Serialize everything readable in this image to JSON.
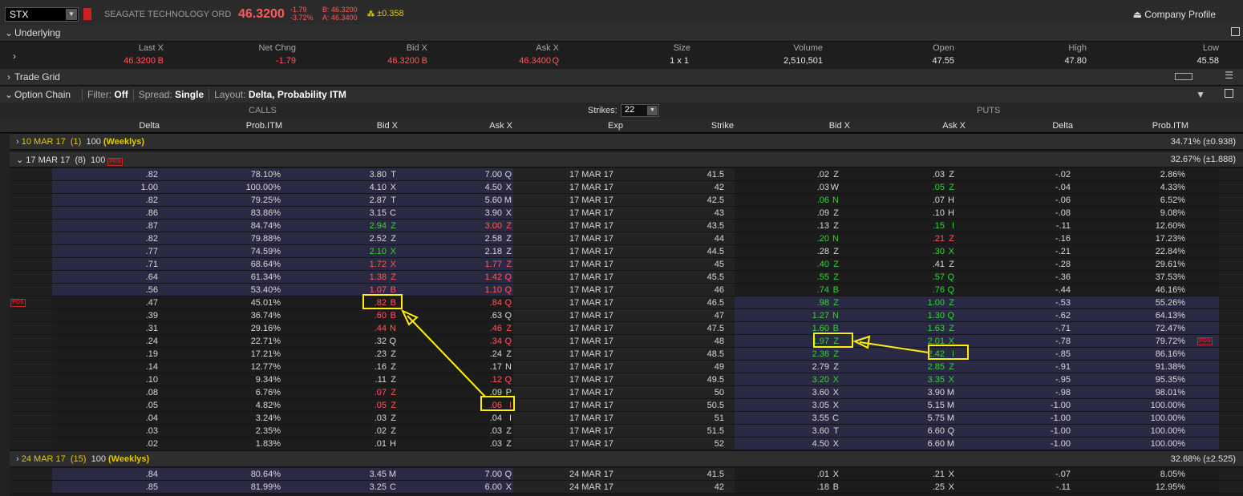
{
  "header": {
    "symbol": "STX",
    "company": "SEAGATE TECHNOLOGY ORD",
    "last": "46.3200",
    "chg1": "-1.79",
    "chg2": "-3.72%",
    "bid": "B: 46.3200",
    "ask": "A: 46.3400",
    "mm": "±0.358",
    "company_profile": "Company Profile"
  },
  "underlying": {
    "title": "Underlying",
    "headers": [
      "Last X",
      "Net Chng",
      "Bid X",
      "Ask X",
      "Size",
      "Volume",
      "Open",
      "High",
      "Low"
    ],
    "last": "46.3200",
    "last_x": "B",
    "net": "-1.79",
    "bid": "46.3200",
    "bid_x": "B",
    "ask": "46.3400",
    "ask_x": "Q",
    "size": "1 x 1",
    "volume": "2,510,501",
    "open": "47.55",
    "high": "47.80",
    "low": "45.58"
  },
  "trade_grid": {
    "title": "Trade Grid"
  },
  "option_chain": {
    "title": "Option Chain",
    "filter_label": "Filter:",
    "filter": "Off",
    "spread_label": "Spread:",
    "spread": "Single",
    "layout_label": "Layout:",
    "layout": "Delta, Probability ITM",
    "calls": "CALLS",
    "puts": "PUTS",
    "strikes_label": "Strikes:",
    "strikes": "22",
    "columns": {
      "delta": "Delta",
      "prob": "Prob.ITM",
      "bid": "Bid X",
      "ask": "Ask X",
      "exp": "Exp",
      "strike": "Strike"
    }
  },
  "groups": [
    {
      "label": "10 MAR 17",
      "count": "(1)",
      "mult": "100",
      "tag": "(Weeklys)",
      "right": "34.71% (±0.938)"
    },
    {
      "label": "17 MAR 17",
      "count": "(8)",
      "mult": "100",
      "tag": "",
      "right": "32.67% (±1.888)"
    },
    {
      "label": "24 MAR 17",
      "count": "(15)",
      "mult": "100",
      "tag": "(Weeklys)",
      "right": "32.68% (±2.525)"
    }
  ],
  "pos_label": "POS",
  "rows": [
    {
      "cd": ".82",
      "cp": "78.10%",
      "cb": "3.80",
      "cbx": "T",
      "ca": "7.00",
      "cax": "Q",
      "exp": "17 MAR 17",
      "k": "41.5",
      "pb": ".02",
      "pbx": "Z",
      "pa": ".03",
      "pax": "Z",
      "pd": "-.02",
      "pp": "2.86%"
    },
    {
      "cd": "1.00",
      "cp": "100.00%",
      "cb": "4.10",
      "cbx": "X",
      "ca": "4.50",
      "cax": "X",
      "exp": "17 MAR 17",
      "k": "42",
      "pb": ".03",
      "pbx": "W",
      "pa": ".05",
      "pax": "Z",
      "pd": "-.04",
      "pp": "4.33%"
    },
    {
      "cd": ".82",
      "cp": "79.25%",
      "cb": "2.87",
      "cbx": "T",
      "ca": "5.60",
      "cax": "M",
      "exp": "17 MAR 17",
      "k": "42.5",
      "pb": ".06",
      "pbx": "N",
      "pa": ".07",
      "pax": "H",
      "pd": "-.06",
      "pp": "6.52%"
    },
    {
      "cd": ".86",
      "cp": "83.86%",
      "cb": "3.15",
      "cbx": "C",
      "ca": "3.90",
      "cax": "X",
      "exp": "17 MAR 17",
      "k": "43",
      "pb": ".09",
      "pbx": "Z",
      "pa": ".10",
      "pax": "H",
      "pd": "-.08",
      "pp": "9.08%"
    },
    {
      "cd": ".87",
      "cp": "84.74%",
      "cb": "2.94",
      "cbx": "Z",
      "ca": "3.00",
      "cax": "Z",
      "exp": "17 MAR 17",
      "k": "43.5",
      "pb": ".13",
      "pbx": "Z",
      "pa": ".15",
      "pax": "I",
      "pd": "-.11",
      "pp": "12.60%"
    },
    {
      "cd": ".82",
      "cp": "79.88%",
      "cb": "2.52",
      "cbx": "Z",
      "ca": "2.58",
      "cax": "Z",
      "exp": "17 MAR 17",
      "k": "44",
      "pb": ".20",
      "pbx": "N",
      "pa": ".21",
      "pax": "Z",
      "pd": "-.16",
      "pp": "17.23%"
    },
    {
      "cd": ".77",
      "cp": "74.59%",
      "cb": "2.10",
      "cbx": "X",
      "ca": "2.18",
      "cax": "Z",
      "exp": "17 MAR 17",
      "k": "44.5",
      "pb": ".28",
      "pbx": "Z",
      "pa": ".30",
      "pax": "X",
      "pd": "-.21",
      "pp": "22.84%"
    },
    {
      "cd": ".71",
      "cp": "68.64%",
      "cb": "1.72",
      "cbx": "X",
      "ca": "1.77",
      "cax": "Z",
      "exp": "17 MAR 17",
      "k": "45",
      "pb": ".40",
      "pbx": "Z",
      "pa": ".41",
      "pax": "Z",
      "pd": "-.28",
      "pp": "29.61%"
    },
    {
      "cd": ".64",
      "cp": "61.34%",
      "cb": "1.38",
      "cbx": "Z",
      "ca": "1.42",
      "cax": "Q",
      "exp": "17 MAR 17",
      "k": "45.5",
      "pb": ".55",
      "pbx": "Z",
      "pa": ".57",
      "pax": "Q",
      "pd": "-.36",
      "pp": "37.53%"
    },
    {
      "cd": ".56",
      "cp": "53.40%",
      "cb": "1.07",
      "cbx": "B",
      "ca": "1.10",
      "cax": "Q",
      "exp": "17 MAR 17",
      "k": "46",
      "pb": ".74",
      "pbx": "B",
      "pa": ".76",
      "pax": "Q",
      "pd": "-.44",
      "pp": "46.16%"
    },
    {
      "cd": ".47",
      "cp": "45.01%",
      "cb": ".82",
      "cbx": "B",
      "ca": ".84",
      "cax": "Q",
      "exp": "17 MAR 17",
      "k": "46.5",
      "pb": ".98",
      "pbx": "Z",
      "pa": "1.00",
      "pax": "Z",
      "pd": "-.53",
      "pp": "55.26%"
    },
    {
      "cd": ".39",
      "cp": "36.74%",
      "cb": ".60",
      "cbx": "B",
      "ca": ".63",
      "cax": "Q",
      "exp": "17 MAR 17",
      "k": "47",
      "pb": "1.27",
      "pbx": "N",
      "pa": "1.30",
      "pax": "Q",
      "pd": "-.62",
      "pp": "64.13%"
    },
    {
      "cd": ".31",
      "cp": "29.16%",
      "cb": ".44",
      "cbx": "N",
      "ca": ".46",
      "cax": "Z",
      "exp": "17 MAR 17",
      "k": "47.5",
      "pb": "1.60",
      "pbx": "B",
      "pa": "1.63",
      "pax": "Z",
      "pd": "-.71",
      "pp": "72.47%"
    },
    {
      "cd": ".24",
      "cp": "22.71%",
      "cb": ".32",
      "cbx": "Q",
      "ca": ".34",
      "cax": "Q",
      "exp": "17 MAR 17",
      "k": "48",
      "pb": "1.97",
      "pbx": "Z",
      "pa": "2.01",
      "pax": "X",
      "pd": "-.78",
      "pp": "79.72%"
    },
    {
      "cd": ".19",
      "cp": "17.21%",
      "cb": ".23",
      "cbx": "Z",
      "ca": ".24",
      "cax": "Z",
      "exp": "17 MAR 17",
      "k": "48.5",
      "pb": "2.36",
      "pbx": "Z",
      "pa": "2.42",
      "pax": "I",
      "pd": "-.85",
      "pp": "86.16%"
    },
    {
      "cd": ".14",
      "cp": "12.77%",
      "cb": ".16",
      "cbx": "Z",
      "ca": ".17",
      "cax": "N",
      "exp": "17 MAR 17",
      "k": "49",
      "pb": "2.79",
      "pbx": "Z",
      "pa": "2.85",
      "pax": "Z",
      "pd": "-.91",
      "pp": "91.38%"
    },
    {
      "cd": ".10",
      "cp": "9.34%",
      "cb": ".11",
      "cbx": "Z",
      "ca": ".12",
      "cax": "Q",
      "exp": "17 MAR 17",
      "k": "49.5",
      "pb": "3.20",
      "pbx": "X",
      "pa": "3.35",
      "pax": "X",
      "pd": "-.95",
      "pp": "95.35%"
    },
    {
      "cd": ".08",
      "cp": "6.76%",
      "cb": ".07",
      "cbx": "Z",
      "ca": ".09",
      "cax": "P",
      "exp": "17 MAR 17",
      "k": "50",
      "pb": "3.60",
      "pbx": "X",
      "pa": "3.90",
      "pax": "M",
      "pd": "-.98",
      "pp": "98.01%"
    },
    {
      "cd": ".05",
      "cp": "4.82%",
      "cb": ".05",
      "cbx": "Z",
      "ca": ".06",
      "cax": "I",
      "exp": "17 MAR 17",
      "k": "50.5",
      "pb": "3.05",
      "pbx": "X",
      "pa": "5.15",
      "pax": "M",
      "pd": "-1.00",
      "pp": "100.00%"
    },
    {
      "cd": ".04",
      "cp": "3.24%",
      "cb": ".03",
      "cbx": "Z",
      "ca": ".04",
      "cax": "I",
      "exp": "17 MAR 17",
      "k": "51",
      "pb": "3.55",
      "pbx": "C",
      "pa": "5.75",
      "pax": "M",
      "pd": "-1.00",
      "pp": "100.00%"
    },
    {
      "cd": ".03",
      "cp": "2.35%",
      "cb": ".02",
      "cbx": "Z",
      "ca": ".03",
      "cax": "Z",
      "exp": "17 MAR 17",
      "k": "51.5",
      "pb": "3.60",
      "pbx": "T",
      "pa": "6.60",
      "pax": "Q",
      "pd": "-1.00",
      "pp": "100.00%"
    },
    {
      "cd": ".02",
      "cp": "1.83%",
      "cb": ".01",
      "cbx": "H",
      "ca": ".03",
      "cax": "Z",
      "exp": "17 MAR 17",
      "k": "52",
      "pb": "4.50",
      "pbx": "X",
      "pa": "6.60",
      "pax": "M",
      "pd": "-1.00",
      "pp": "100.00%"
    }
  ],
  "rows24": [
    {
      "cd": ".84",
      "cp": "80.64%",
      "cb": "3.45",
      "cbx": "M",
      "ca": "7.00",
      "cax": "Q",
      "exp": "24 MAR 17",
      "k": "41.5",
      "pb": ".01",
      "pbx": "X",
      "pa": ".21",
      "pax": "X",
      "pd": "-.07",
      "pp": "8.05%"
    },
    {
      "cd": ".85",
      "cp": "81.99%",
      "cb": "3.25",
      "cbx": "C",
      "ca": "6.00",
      "cax": "X",
      "exp": "24 MAR 17",
      "k": "42",
      "pb": ".18",
      "pbx": "B",
      "pa": ".25",
      "pax": "X",
      "pd": "-.11",
      "pp": "12.95%"
    }
  ],
  "colors": {
    "up": "#3ccf3c",
    "down": "#ff5a5a",
    "itm_row": "#2a2a44",
    "highlight": "#ffef00"
  }
}
